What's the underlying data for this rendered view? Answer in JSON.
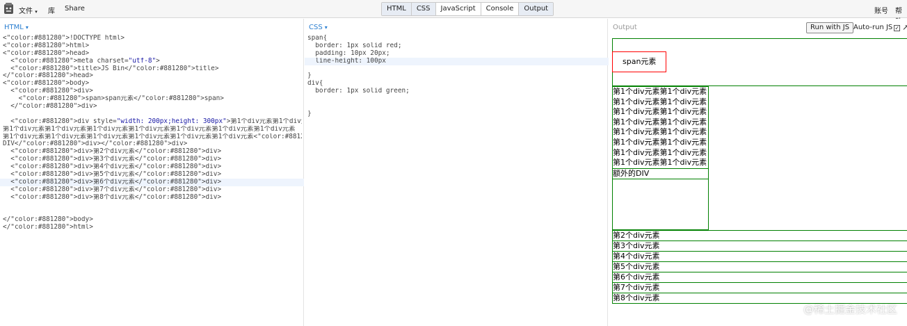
{
  "topbar": {
    "menu_file": "文件",
    "menu_file_caret": "▾",
    "menu_library": "库",
    "menu_share": "Share",
    "tabs": [
      "HTML",
      "CSS",
      "JavaScript",
      "Console",
      "Output"
    ],
    "account": "账号",
    "help": "帮助"
  },
  "html_panel": {
    "label": "HTML",
    "caret": "▾",
    "lines": [
      "<!DOCTYPE html>",
      "<html>",
      "<head>",
      "  <meta charset=\"utf-8\">",
      "  <title>JS Bin</title>",
      "</head>",
      "<body>",
      "  <div>",
      "    <span>span元素</span>",
      "  </div>",
      "",
      "  <div style=\"width: 200px;height: 300px\">第1个div元素第1个div元素第1个div元素",
      "第1个div元素第1个div元素第1个div元素第1个div元素第1个div元素第1个div元素第1个div元素",
      "第1个div元素第1个div元素第1个div元素第1个div元素第1个div元素第1个div元素<div>额外的",
      "DIV</div></div>",
      "  <div>第2个div元素</div>",
      "  <div>第3个div元素</div>",
      "  <div>第4个div元素</div>",
      "  <div>第5个div元素</div>",
      "  <div>第6个div元素</div>",
      "  <div>第7个div元素</div>",
      "  <div>第8个div元素</div>",
      "",
      "",
      "</body>",
      "</html>"
    ]
  },
  "css_panel": {
    "label": "CSS",
    "caret": "▾",
    "lines": [
      "span{",
      "  border: 1px solid red;",
      "  padding: 10px 20px;",
      "  line-height: 100px",
      "",
      "}",
      "div{",
      "  border: 1px solid green;",
      "",
      "",
      "}"
    ]
  },
  "output_panel": {
    "title": "Output",
    "run_button": "Run with JS",
    "autorun_label": "Auto-run JS",
    "autorun_check": "✓",
    "expand_glyph": "↗",
    "span_text": "span元素",
    "first_div_lines": [
      "第1个div元素第1个div元素",
      "第1个div元素第1个div元素",
      "第1个div元素第1个div元素",
      "第1个div元素第1个div元素",
      "第1个div元素第1个div元素",
      "第1个div元素第1个div元素",
      "第1个div元素第1个div元素",
      "第1个div元素第1个div元素"
    ],
    "extra_div": "额外的DIV",
    "other_divs": [
      "第2个div元素",
      "第3个div元素",
      "第4个div元素",
      "第5个div元素",
      "第6个div元素",
      "第7个div元素",
      "第8个div元素"
    ]
  },
  "watermark": "@稀土掘金技术社区"
}
